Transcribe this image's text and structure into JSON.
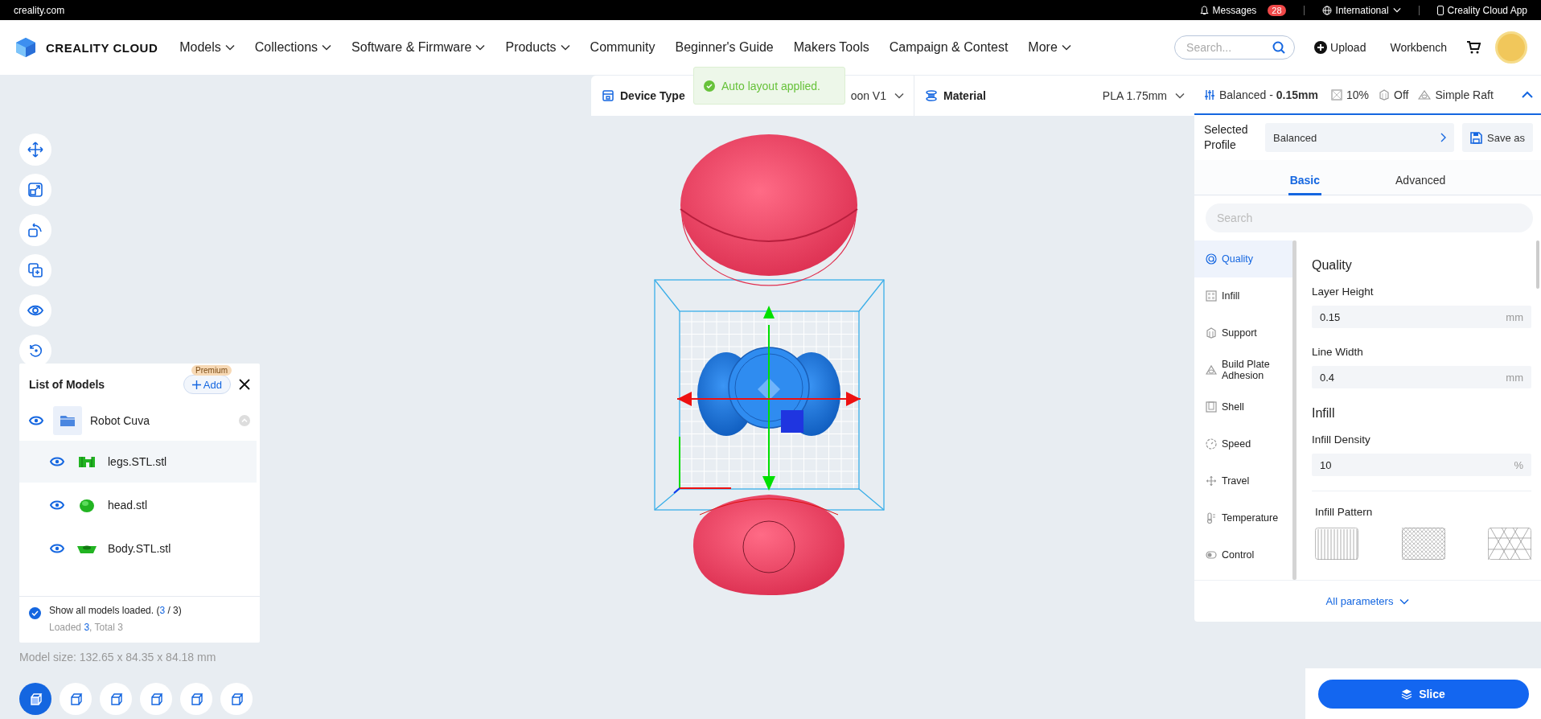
{
  "top_bar": {
    "site": "creality.com",
    "messages": {
      "label": "Messages",
      "count": "28"
    },
    "region": "International",
    "app": "Creality Cloud App"
  },
  "nav": {
    "logo": "CREALITY CLOUD",
    "items": [
      {
        "label": "Models",
        "dropdown": true
      },
      {
        "label": "Collections",
        "dropdown": true
      },
      {
        "label": "Software & Firmware",
        "dropdown": true
      },
      {
        "label": "Products",
        "dropdown": true
      },
      {
        "label": "Community",
        "dropdown": false
      },
      {
        "label": "Beginner's Guide",
        "dropdown": false
      },
      {
        "label": "Makers Tools",
        "dropdown": false
      },
      {
        "label": "Campaign & Contest",
        "dropdown": false
      },
      {
        "label": "More",
        "dropdown": true
      }
    ],
    "search": {
      "placeholder": "Search..."
    },
    "upload": "Upload",
    "workbench": "Workbench"
  },
  "toast": {
    "kind": "success",
    "text": "Auto layout applied."
  },
  "device_bar": {
    "device_type": {
      "label": "Device Type",
      "value": "oon V1"
    },
    "material": {
      "label": "Material",
      "value": "PLA 1.75mm"
    }
  },
  "print_summary": {
    "profile": "Balanced - **0.15mm**",
    "infill": "10%",
    "support": "Off",
    "adhesion": "Simple Raft",
    "expanded": true
  },
  "profile": {
    "label": "Selected Profile",
    "value": "Balanced",
    "save": "Save as"
  },
  "tabs": [
    {
      "label": "Basic",
      "selected": true
    },
    {
      "label": "Advanced",
      "selected": false
    }
  ],
  "settings_search": {
    "placeholder": "Search"
  },
  "categories": [
    {
      "kind": "quality",
      "label": "Quality",
      "selected": true
    },
    {
      "kind": "infill",
      "label": "Infill",
      "selected": false
    },
    {
      "kind": "support",
      "label": "Support",
      "selected": false
    },
    {
      "kind": "adhesion",
      "label": "Build Plate Adhesion",
      "selected": false
    },
    {
      "kind": "shell",
      "label": "Shell",
      "selected": false
    },
    {
      "kind": "speed",
      "label": "Speed",
      "selected": false
    },
    {
      "kind": "travel",
      "label": "Travel",
      "selected": false
    },
    {
      "kind": "temperature",
      "label": "Temperature",
      "selected": false
    },
    {
      "kind": "control",
      "label": "Control",
      "selected": false
    }
  ],
  "settings": [
    {
      "kind": "heading",
      "label": "Quality"
    },
    {
      "kind": "field",
      "label": "Layer Height",
      "value": "0.15",
      "unit": "mm"
    },
    {
      "kind": "field",
      "label": "Line Width",
      "value": "0.4",
      "unit": "mm"
    },
    {
      "kind": "heading",
      "label": "Infill"
    },
    {
      "kind": "field",
      "label": "Infill Density",
      "value": "10",
      "unit": "%"
    },
    {
      "kind": "patterns",
      "label": "Infill Pattern"
    }
  ],
  "all_parameters": "All parameters",
  "models_panel": {
    "title": "List of Models",
    "add": "Add",
    "badge": "Premium",
    "group": {
      "name": "Robot Cuva",
      "visible": true,
      "expanded": true,
      "children": [
        {
          "name": "legs.STL.stl",
          "visible": true,
          "selected": true,
          "kind": "legs"
        },
        {
          "name": "head.stl",
          "visible": true,
          "selected": false,
          "kind": "head"
        },
        {
          "name": "Body.STL.stl",
          "visible": true,
          "selected": false,
          "kind": "body"
        }
      ]
    },
    "show_all": {
      "checked": true,
      "parts": [
        {
          "text": "Show all models loaded. (",
          "highlight": false
        },
        {
          "text": "3",
          "highlight": true
        },
        {
          "text": " / 3)",
          "highlight": false
        }
      ]
    },
    "loaded": {
      "parts": [
        {
          "text": "Loaded ",
          "highlight": false
        },
        {
          "text": "3",
          "highlight": true
        },
        {
          "text": ", Total 3",
          "highlight": false
        }
      ]
    }
  },
  "model_size": "Model size: 132.65 x 84.35 x 84.18 mm",
  "view_buttons": [
    {
      "selected": true
    },
    {
      "selected": false
    },
    {
      "selected": false
    },
    {
      "selected": false
    },
    {
      "selected": false
    },
    {
      "selected": false
    }
  ],
  "slice": "Slice"
}
